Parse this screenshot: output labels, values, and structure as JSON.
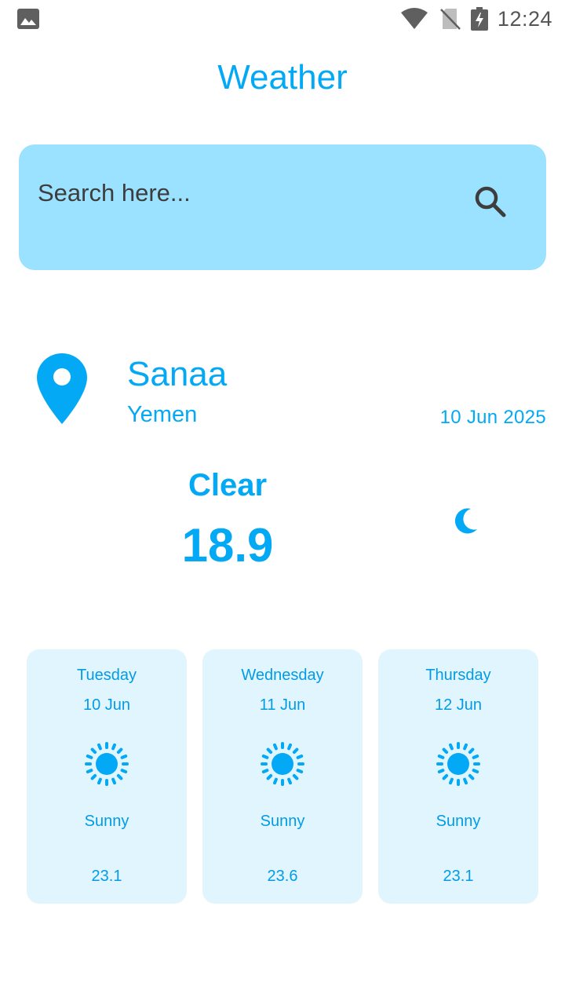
{
  "status_bar": {
    "time": "12:24",
    "icons": [
      "gallery-icon",
      "wifi-icon",
      "no-sim-icon",
      "battery-charging-icon"
    ]
  },
  "app": {
    "title": "Weather"
  },
  "search": {
    "placeholder": "Search here...",
    "value": "",
    "icon": "search-icon"
  },
  "location": {
    "icon": "location-pin-icon",
    "city": "Sanaa",
    "country": "Yemen",
    "date": "10 Jun 2025"
  },
  "current": {
    "condition": "Clear",
    "temperature": "18.9",
    "icon": "moon-icon"
  },
  "forecast": [
    {
      "day": "Tuesday",
      "date": "10 Jun",
      "condition": "Sunny",
      "temp": "23.1",
      "icon": "sun-icon"
    },
    {
      "day": "Wednesday",
      "date": "11 Jun",
      "condition": "Sunny",
      "temp": "23.6",
      "icon": "sun-icon"
    },
    {
      "day": "Thursday",
      "date": "12 Jun",
      "condition": "Sunny",
      "temp": "23.1",
      "icon": "sun-icon"
    }
  ],
  "colors": {
    "accent": "#03A9F4",
    "search_bg": "#9AE2FF",
    "card_bg": "#E1F5FE",
    "card_text": "#039BE5"
  }
}
